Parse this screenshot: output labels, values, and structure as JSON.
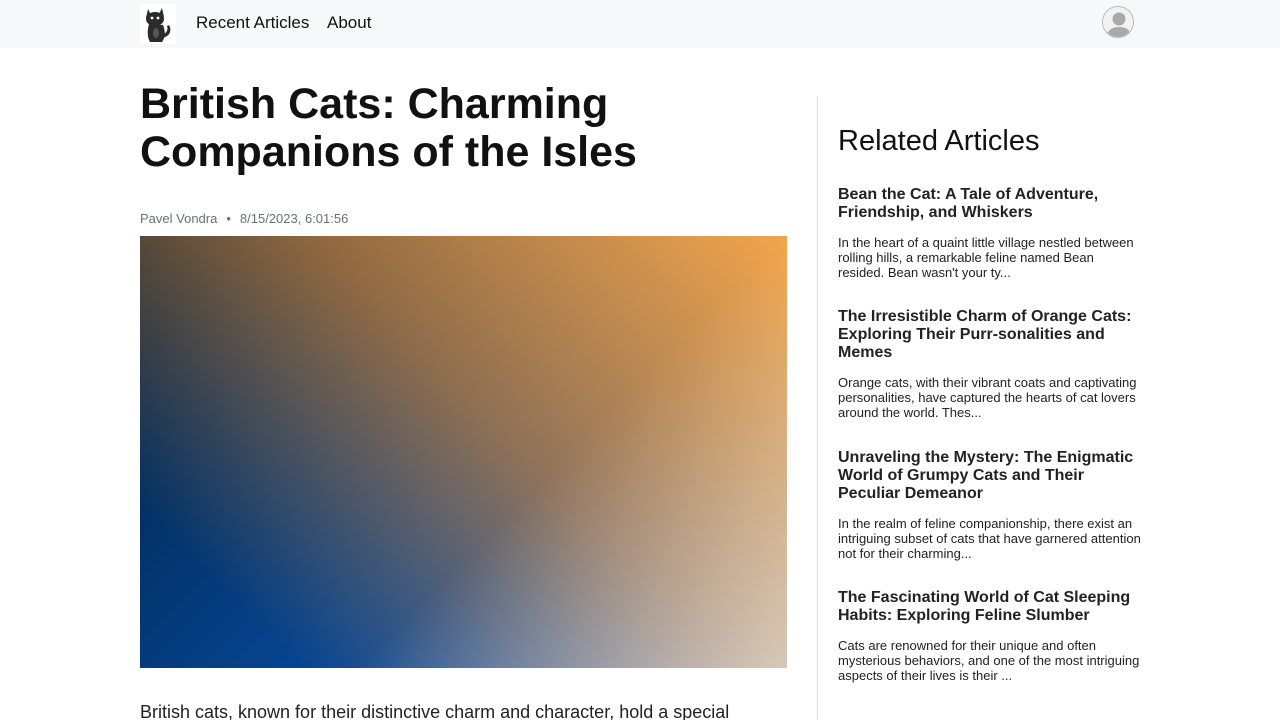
{
  "nav": {
    "logo_icon": "cat-logo-icon",
    "links": [
      {
        "label": "Recent Articles"
      },
      {
        "label": "About"
      }
    ],
    "avatar_icon": "user-avatar-icon"
  },
  "article": {
    "title": "British Cats: Charming Companions of the Isles",
    "author": "Pavel Vondra",
    "separator": "•",
    "date": "8/15/2023, 6:01:56",
    "hero_colors": [
      "#00203f",
      "#0b63d6",
      "#ff9a2e",
      "#fde6cc"
    ],
    "intro": "British cats, known for their distinctive charm and character, hold a special"
  },
  "sidebar": {
    "heading": "Related Articles",
    "items": [
      {
        "title": "Bean the Cat: A Tale of Adventure, Friendship, and Whiskers",
        "excerpt": "In the heart of a quaint little village nestled between rolling hills, a remarkable feline named Bean resided. Bean wasn't your ty..."
      },
      {
        "title": "The Irresistible Charm of Orange Cats: Exploring Their Purr-sonalities and Memes",
        "excerpt": "Orange cats, with their vibrant coats and captivating personalities, have captured the hearts of cat lovers around the world. Thes..."
      },
      {
        "title": "Unraveling the Mystery: The Enigmatic World of Grumpy Cats and Their Peculiar Demeanor",
        "excerpt": "In the realm of feline companionship, there exist an intriguing subset of cats that have garnered attention not for their charming..."
      },
      {
        "title": "The Fascinating World of Cat Sleeping Habits: Exploring Feline Slumber",
        "excerpt": "Cats are renowned for their unique and often mysterious behaviors, and one of the most intriguing aspects of their lives is their ..."
      }
    ]
  }
}
